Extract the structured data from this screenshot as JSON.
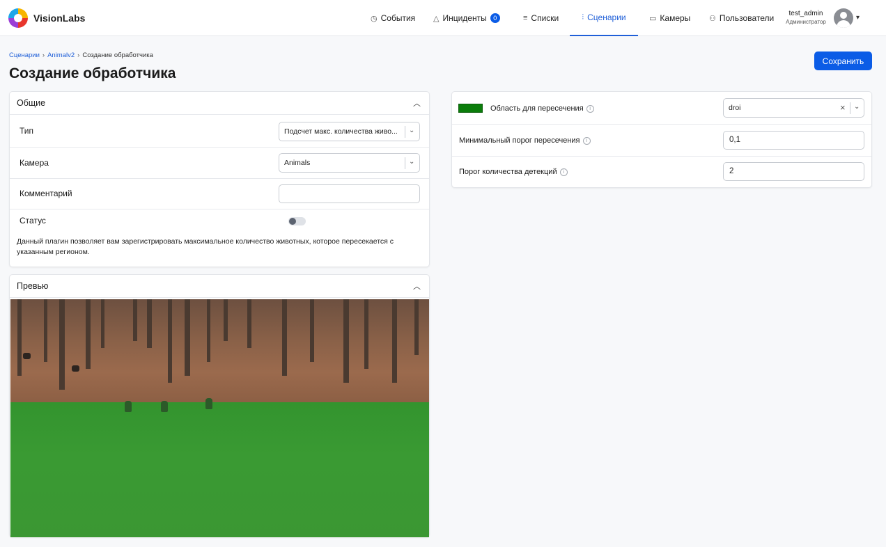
{
  "app": {
    "brand": "VisionLabs"
  },
  "nav": {
    "events": "События",
    "incidents": "Инциденты",
    "incidents_count": "0",
    "lists": "Списки",
    "scenarios": "Сценарии",
    "cameras": "Камеры",
    "users": "Пользователи"
  },
  "user": {
    "name": "test_admin",
    "role": "Администратор"
  },
  "breadcrumb": {
    "root": "Сценарии",
    "parent": "Animalv2",
    "current": "Создание обработчика"
  },
  "page": {
    "title": "Создание обработчика",
    "save_label": "Сохранить"
  },
  "general": {
    "title": "Общие",
    "type_label": "Тип",
    "type_value": "Подсчет макс. количества живо...",
    "camera_label": "Камера",
    "camera_value": "Animals",
    "comment_label": "Комментарий",
    "comment_value": "",
    "status_label": "Статус",
    "status_enabled": false,
    "description": "Данный плагин позволяет вам зарегистрировать максимальное количество животных, которое пересекается с указанным регионом."
  },
  "preview": {
    "title": "Превью"
  },
  "settings": {
    "region_label": "Область для пересечения",
    "region_color": "#0b7d0b",
    "region_value": "droi",
    "min_threshold_label": "Минимальный порог пересечения",
    "min_threshold_value": "0,1",
    "detection_threshold_label": "Порог количества детекций",
    "detection_threshold_value": "2"
  },
  "colors": {
    "accent": "#0b5ce6",
    "region_overlay": "#33942e"
  }
}
